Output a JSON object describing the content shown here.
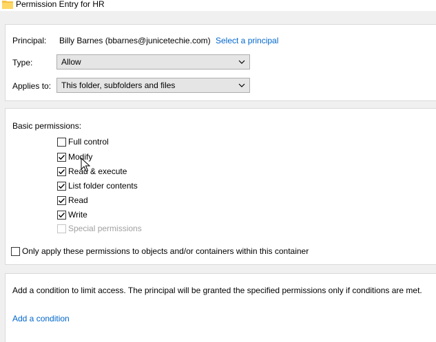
{
  "window": {
    "title": "Permission Entry for HR",
    "icon": "folder-icon"
  },
  "principal": {
    "label": "Principal:",
    "value": "Billy Barnes (bbarnes@junicetechie.com)",
    "select_link": "Select a principal"
  },
  "type": {
    "label": "Type:",
    "selected": "Allow"
  },
  "applies_to": {
    "label": "Applies to:",
    "selected": "This folder, subfolders and files"
  },
  "basic_permissions": {
    "heading": "Basic permissions:",
    "items": [
      {
        "label": "Full control",
        "checked": false,
        "disabled": false
      },
      {
        "label": "Modify",
        "checked": true,
        "disabled": false
      },
      {
        "label": "Read & execute",
        "checked": true,
        "disabled": false
      },
      {
        "label": "List folder contents",
        "checked": true,
        "disabled": false
      },
      {
        "label": "Read",
        "checked": true,
        "disabled": false
      },
      {
        "label": "Write",
        "checked": true,
        "disabled": false
      },
      {
        "label": "Special permissions",
        "checked": false,
        "disabled": true
      }
    ]
  },
  "only_apply": {
    "label": "Only apply these permissions to objects and/or containers within this container",
    "checked": false
  },
  "condition": {
    "description": "Add a condition to limit access. The principal will be granted the specified permissions only if conditions are met.",
    "add_link": "Add a condition"
  },
  "colors": {
    "link": "#0066cc",
    "panel": "#ffffff",
    "background": "#f0f0f0",
    "folder": "#f5c242"
  }
}
